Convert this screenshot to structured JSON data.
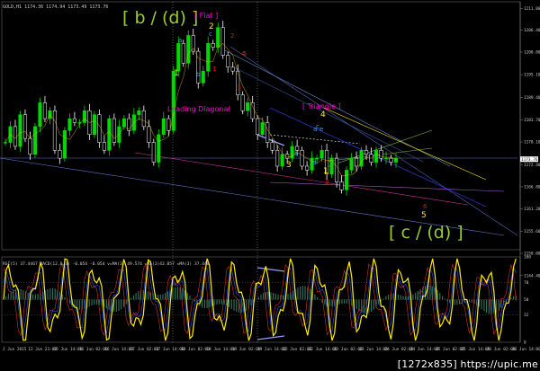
{
  "header": {
    "symbol_line": "GOLD,H1",
    "ohlc": "1174.36 1174.94 1173.49 1173.76"
  },
  "indicator_header": "RSI(5) 37.4467 MACD(12,8,3) -0.054 -0.054 v=MA(3) 49.574 =MA(3)43.857 =MA(3) 37.440",
  "watermark": "[1272x835] https://upic.me",
  "colors": {
    "bull": "#00d800",
    "bear": "#ffffff",
    "wave_green": "#99cc33",
    "pink": "#ff00cc",
    "yellow": "#ffee00",
    "red": "#ee1111",
    "cyan": "#22aaee",
    "purple": "#9933cc"
  },
  "annotations": {
    "b_d": "[ b / (d) ]",
    "flat": "[ Flat ]",
    "leading": "Leading Diagonal",
    "triangle": "[ Triangle ]",
    "c_d": "[ c / (d) ]"
  },
  "wave_labels": [
    {
      "t": "a",
      "c": "cyan"
    },
    {
      "t": "b",
      "c": "cyan"
    },
    {
      "t": "c",
      "c": "cyan"
    },
    {
      "t": "1",
      "c": "yellow"
    },
    {
      "t": "2",
      "c": "yellow"
    },
    {
      "t": "3",
      "c": "yellow"
    },
    {
      "t": "4",
      "c": "yellow"
    },
    {
      "t": "5",
      "c": "yellow"
    },
    {
      "t": "1",
      "c": "red"
    },
    {
      "t": "2",
      "c": "red"
    },
    {
      "t": "3",
      "c": "red"
    },
    {
      "t": "4",
      "c": "red"
    },
    {
      "t": "5",
      "c": "red"
    },
    {
      "t": "a",
      "c": "cyan"
    },
    {
      "t": "b",
      "c": "cyan"
    },
    {
      "t": "c",
      "c": "cyan"
    },
    {
      "t": "d",
      "c": "cyan"
    },
    {
      "t": "e",
      "c": "cyan"
    },
    {
      "t": "1",
      "c": "yellow"
    },
    {
      "t": "3",
      "c": "red"
    },
    {
      "t": "6",
      "c": "red"
    }
  ],
  "chart_data": {
    "type": "candlestick",
    "symbol": "GOLD",
    "timeframe": "H1",
    "price_axis_labels": [
      "1211.80",
      "1206.40",
      "1200.80",
      "1195.10",
      "1189.40",
      "1183.70",
      "1178.10",
      "1172.40",
      "1166.80",
      "1161.20",
      "1155.60",
      "1150.00",
      "1144.40"
    ],
    "price_range": [
      1150.9,
      1213.5
    ],
    "current_price": "1173.76",
    "time_labels": [
      "2 Jun 2015",
      "12 Jun 23:00",
      "15 Jun 14:00",
      "16 Jun 02:00",
      "16 Jun 14:00",
      "17 Jun 02:00",
      "17 Jun 14:00",
      "18 Jun 02:00",
      "18 Jun 14:00",
      "19 Jun 02:00",
      "19 Jun 14:00",
      "22 Jun 02:00",
      "22 Jun 14:00",
      "23 Jun 02:00",
      "23 Jun 14:00",
      "24 Jun 02:00",
      "24 Jun 14:00",
      "25 Jun 02:00",
      "25 Jun 14:00",
      "26 Jun 02:00",
      "26 Jun 14:00"
    ],
    "close_path": [
      1178,
      1182,
      1177,
      1185,
      1179,
      1175,
      1182,
      1188,
      1184,
      1186,
      1176,
      1174,
      1181,
      1184,
      1183,
      1183,
      1186,
      1180,
      1185,
      1178,
      1176,
      1184,
      1178,
      1182,
      1184,
      1181,
      1185,
      1186,
      1182,
      1178,
      1173,
      1180,
      1184,
      1181,
      1196,
      1203,
      1198,
      1205,
      1201,
      1193,
      1196,
      1203,
      1202,
      1207,
      1200,
      1197,
      1196,
      1190,
      1186,
      1188,
      1184,
      1180,
      1183,
      1178,
      1176,
      1172,
      1175,
      1174,
      1177,
      1176,
      1172,
      1171,
      1174,
      1174,
      1176,
      1170,
      1174,
      1168,
      1166,
      1171,
      1174,
      1172,
      1176,
      1175,
      1173,
      1176,
      1174,
      1174,
      1173,
      1174
    ],
    "rsi_levels": [
      70,
      50,
      32
    ],
    "rsi_axis_labels": [
      "100",
      "70",
      "50",
      "32",
      "0"
    ]
  }
}
